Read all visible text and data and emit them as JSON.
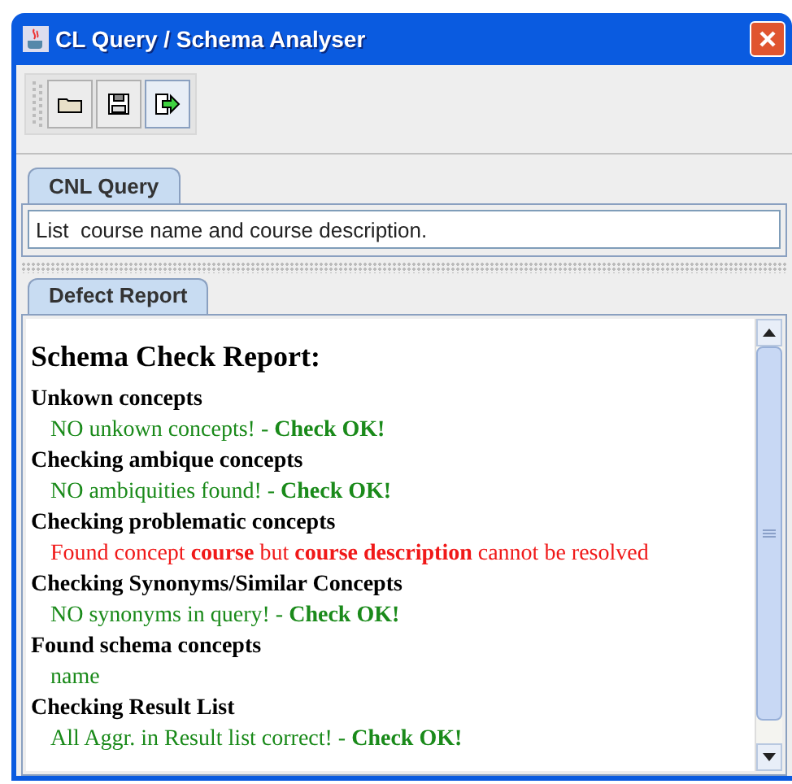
{
  "window": {
    "title": "CL Query / Schema Analyser"
  },
  "toolbar": {
    "buttons": [
      {
        "kind": "open",
        "selected": false
      },
      {
        "kind": "save",
        "selected": false
      },
      {
        "kind": "exit",
        "selected": true
      }
    ]
  },
  "query_tabs": [
    {
      "label": "CNL Query",
      "selected": true
    }
  ],
  "query_field": {
    "value": "List  course name and course description."
  },
  "report_tabs": [
    {
      "label": "Defect Report",
      "selected": true
    }
  ],
  "report": {
    "title": "Schema Check Report:",
    "sections": [
      {
        "heading": "Unkown concepts",
        "message": {
          "kind": "ok",
          "text": "NO unkown concepts! - **Check OK!**"
        }
      },
      {
        "heading": "Checking ambique concepts",
        "message": {
          "kind": "ok",
          "text": "NO ambiquities found! - **Check OK!**"
        }
      },
      {
        "heading": "Checking problematic concepts",
        "message": {
          "kind": "error",
          "text": "Found concept **course** but **course description** cannot be resolved"
        }
      },
      {
        "heading": "Checking Synonyms/Similar Concepts",
        "message": {
          "kind": "ok",
          "text": "NO synonyms in query! - **Check OK!**"
        }
      },
      {
        "heading": "Found schema concepts",
        "message": {
          "kind": "ok",
          "text": "name"
        }
      },
      {
        "heading": "Checking Result List",
        "message": {
          "kind": "ok",
          "text": "All Aggr. in Result list correct! - **Check OK!**"
        }
      }
    ]
  }
}
